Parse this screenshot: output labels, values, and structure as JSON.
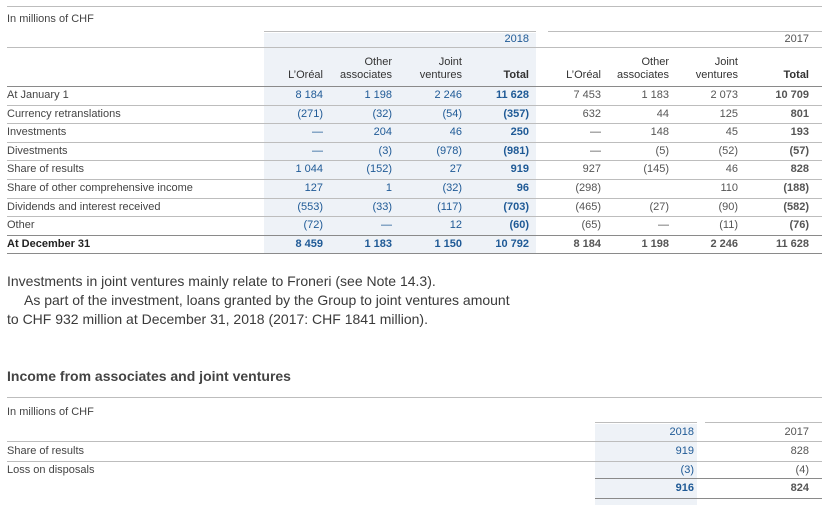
{
  "table1": {
    "unit_label": "In millions of CHF",
    "year_2018": "2018",
    "year_2017": "2017",
    "col_headers": [
      "L’Oréal",
      "Other\nassociates",
      "Joint\nventures",
      "Total",
      "L’Oréal",
      "Other\nassociates",
      "Joint\nventures",
      "Total"
    ],
    "rows": [
      {
        "label": "At January 1",
        "values": [
          "8 184",
          "1 198",
          "2 246",
          "11 628",
          "7 453",
          "1 183",
          "2 073",
          "10 709"
        ],
        "bold": false
      },
      {
        "label": "Currency retranslations",
        "values": [
          "(271)",
          "(32)",
          "(54)",
          "(357)",
          "632",
          "44",
          "125",
          "801"
        ],
        "bold": false
      },
      {
        "label": "Investments",
        "values": [
          "—",
          "204",
          "46",
          "250",
          "—",
          "148",
          "45",
          "193"
        ],
        "bold": false
      },
      {
        "label": "Divestments",
        "values": [
          "—",
          "(3)",
          "(978)",
          "(981)",
          "—",
          "(5)",
          "(52)",
          "(57)"
        ],
        "bold": false
      },
      {
        "label": "Share of results",
        "values": [
          "1 044",
          "(152)",
          "27",
          "919",
          "927",
          "(145)",
          "46",
          "828"
        ],
        "bold": false
      },
      {
        "label": "Share of other comprehensive income",
        "values": [
          "127",
          "1",
          "(32)",
          "96",
          "(298)",
          "",
          "110",
          "(188)"
        ],
        "bold": false
      },
      {
        "label": "Dividends and interest received",
        "values": [
          "(553)",
          "(33)",
          "(117)",
          "(703)",
          "(465)",
          "(27)",
          "(90)",
          "(582)"
        ],
        "bold": false
      },
      {
        "label": "Other",
        "values": [
          "(72)",
          "—",
          "12",
          "(60)",
          "(65)",
          "—",
          "(11)",
          "(76)"
        ],
        "bold": false
      },
      {
        "label": "At December 31",
        "values": [
          "8 459",
          "1 183",
          "1 150",
          "10 792",
          "8 184",
          "1 198",
          "2 246",
          "11 628"
        ],
        "bold": true
      }
    ]
  },
  "note": {
    "line1": "Investments in joint ventures mainly relate to Froneri (see Note 14.3).",
    "line2": "As part of the investment, loans granted by the Group to joint ventures amount",
    "line3": "to CHF 932 million at December 31, 2018 (2017: CHF 1841 million)."
  },
  "section2": {
    "title": "Income from associates and joint ventures",
    "unit_label": "In millions of CHF",
    "year_2018": "2018",
    "year_2017": "2017",
    "rows": [
      {
        "label": "Share of results",
        "v2018": "919",
        "v2017": "828"
      },
      {
        "label": "Loss on disposals",
        "v2018": "(3)",
        "v2017": "(4)"
      }
    ],
    "total_2018": "916",
    "total_2017": "824"
  },
  "colors": {
    "accent_blue": "#1f5a96",
    "shade": "#eef2f7"
  }
}
